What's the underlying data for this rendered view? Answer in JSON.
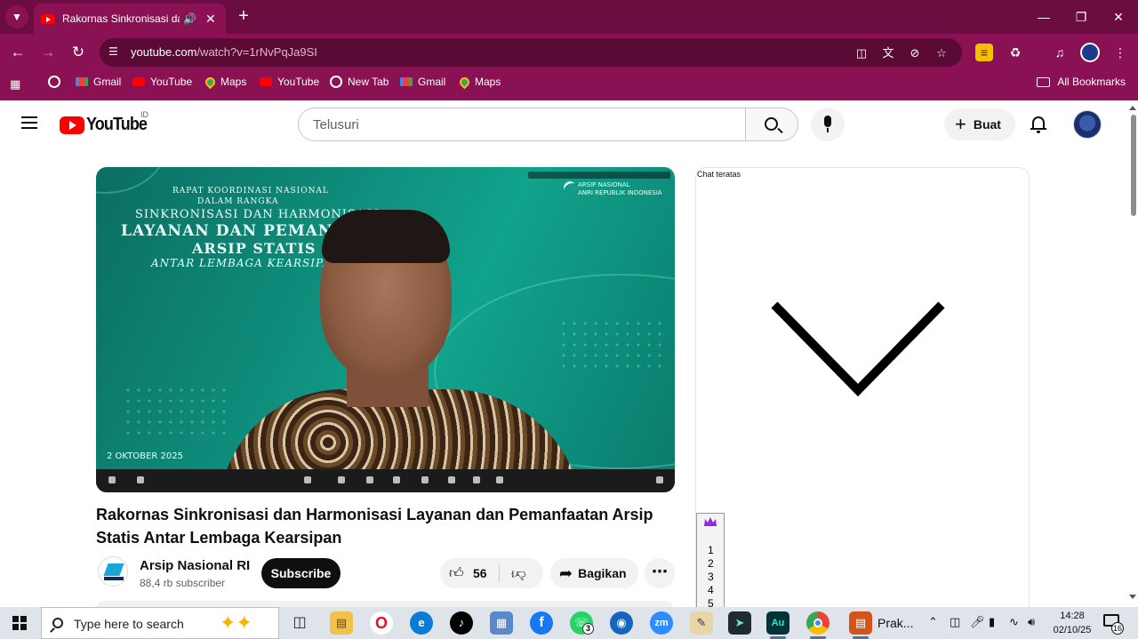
{
  "browser": {
    "tab_title": "Rakornas Sinkronisasi dan H",
    "url_domain": "youtube.com",
    "url_path": "/watch?v=1rNvPqJa9SI",
    "bookmarks": [
      {
        "label": "Gmail",
        "icon": "gmail-icon"
      },
      {
        "label": "YouTube",
        "icon": "youtube-icon"
      },
      {
        "label": "Maps",
        "icon": "maps-icon"
      },
      {
        "label": "YouTube",
        "icon": "youtube-icon"
      },
      {
        "label": "New Tab",
        "icon": "globe-icon"
      },
      {
        "label": "Gmail",
        "icon": "gmail-icon"
      },
      {
        "label": "Maps",
        "icon": "maps-icon"
      }
    ],
    "all_bookmarks_label": "All Bookmarks",
    "accent_color": "#8a1254"
  },
  "youtube": {
    "logo_text": "YouTube",
    "country_code": "ID",
    "search_placeholder": "Telusuri",
    "create_label": "Buat"
  },
  "video": {
    "overlay_lines": [
      "RAPAT KOORDINASI NASIONAL",
      "DALAM RANGKA",
      "SINKRONISASI DAN HARMONISASI",
      "LAYANAN DAN PEMANFAATAN",
      "ARSIP STATIS",
      "ANTAR LEMBAGA KEARSIPAN"
    ],
    "overlay_logo_line1": "ARSIP NASIONAL",
    "overlay_logo_line2": "ANRI REPUBLIK INDONESIA",
    "overlay_date": "2 OKTOBER 2025",
    "title": "Rakornas Sinkronisasi dan Harmonisasi Layanan dan Pemanfaatan Arsip Statis Antar Lembaga Kearsipan",
    "channel_name": "Arsip Nasional RI",
    "subscriber_count": "88,4 rb subscriber",
    "subscribe_label": "Subscribe",
    "like_count": "56",
    "share_label": "Bagikan"
  },
  "chat": {
    "title": "Chat teratas",
    "side_numbers": [
      "1",
      "2",
      "3",
      "4",
      "5"
    ]
  },
  "taskbar": {
    "search_placeholder": "Type here to search",
    "whatsapp_badge": "3",
    "prak_label": "Prak...",
    "time": "14:28",
    "date": "02/10/25",
    "notification_count": "16"
  }
}
